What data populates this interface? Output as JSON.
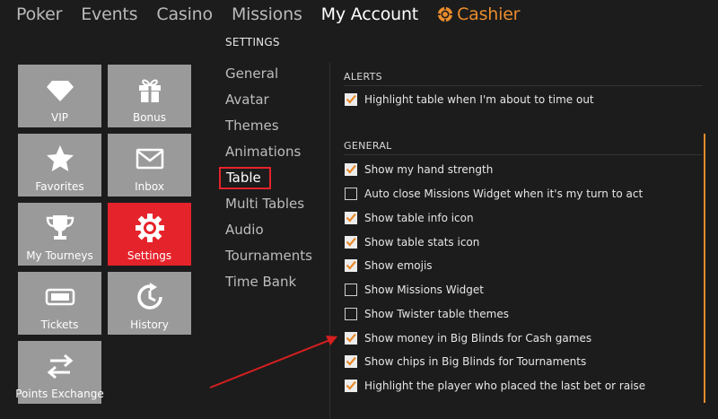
{
  "topnav": {
    "items": [
      {
        "label": "Poker",
        "active": false
      },
      {
        "label": "Events",
        "active": false
      },
      {
        "label": "Casino",
        "active": false
      },
      {
        "label": "Missions",
        "active": false
      },
      {
        "label": "My Account",
        "active": true
      }
    ],
    "cashier_label": "Cashier",
    "cashier_color": "#e98b2c"
  },
  "tiles": [
    {
      "label": "VIP",
      "icon": "diamond-icon",
      "active": false
    },
    {
      "label": "Bonus",
      "icon": "gift-icon",
      "active": false
    },
    {
      "label": "Favorites",
      "icon": "star-icon",
      "active": false
    },
    {
      "label": "Inbox",
      "icon": "envelope-icon",
      "active": false
    },
    {
      "label": "My Tourneys",
      "icon": "trophy-icon",
      "active": false
    },
    {
      "label": "Settings",
      "icon": "gear-icon",
      "active": true
    },
    {
      "label": "Tickets",
      "icon": "ticket-icon",
      "active": false
    },
    {
      "label": "History",
      "icon": "history-icon",
      "active": false
    },
    {
      "label": "Points Exchange",
      "icon": "exchange-arrows-icon",
      "active": false
    }
  ],
  "settings": {
    "title": "SETTINGS",
    "menu": [
      {
        "label": "General",
        "selected": false
      },
      {
        "label": "Avatar",
        "selected": false
      },
      {
        "label": "Themes",
        "selected": false
      },
      {
        "label": "Animations",
        "selected": false
      },
      {
        "label": "Table",
        "selected": true
      },
      {
        "label": "Multi Tables",
        "selected": false
      },
      {
        "label": "Audio",
        "selected": false
      },
      {
        "label": "Tournaments",
        "selected": false
      },
      {
        "label": "Time Bank",
        "selected": false
      }
    ]
  },
  "alerts": {
    "title": "ALERTS",
    "options": [
      {
        "label": "Highlight table when I'm about to time out",
        "checked": true
      }
    ]
  },
  "general": {
    "title": "GENERAL",
    "options": [
      {
        "label": "Show my hand strength",
        "checked": true
      },
      {
        "label": "Auto close Missions Widget when it's my turn to act",
        "checked": false
      },
      {
        "label": "Show table info icon",
        "checked": true
      },
      {
        "label": "Show table stats icon",
        "checked": true
      },
      {
        "label": "Show emojis",
        "checked": true
      },
      {
        "label": "Show Missions Widget",
        "checked": false
      },
      {
        "label": "Show Twister table themes",
        "checked": false
      },
      {
        "label": "Show money in Big Blinds for Cash games",
        "checked": true
      },
      {
        "label": "Show chips in Big Blinds for Tournaments",
        "checked": true
      },
      {
        "label": "Highlight the player who placed the last bet or raise",
        "checked": true
      }
    ]
  },
  "colors": {
    "accent_orange": "#e98b2c",
    "active_red": "#e5232b",
    "tile_gray": "#9a9a9a",
    "background": "#1c1c1c"
  }
}
